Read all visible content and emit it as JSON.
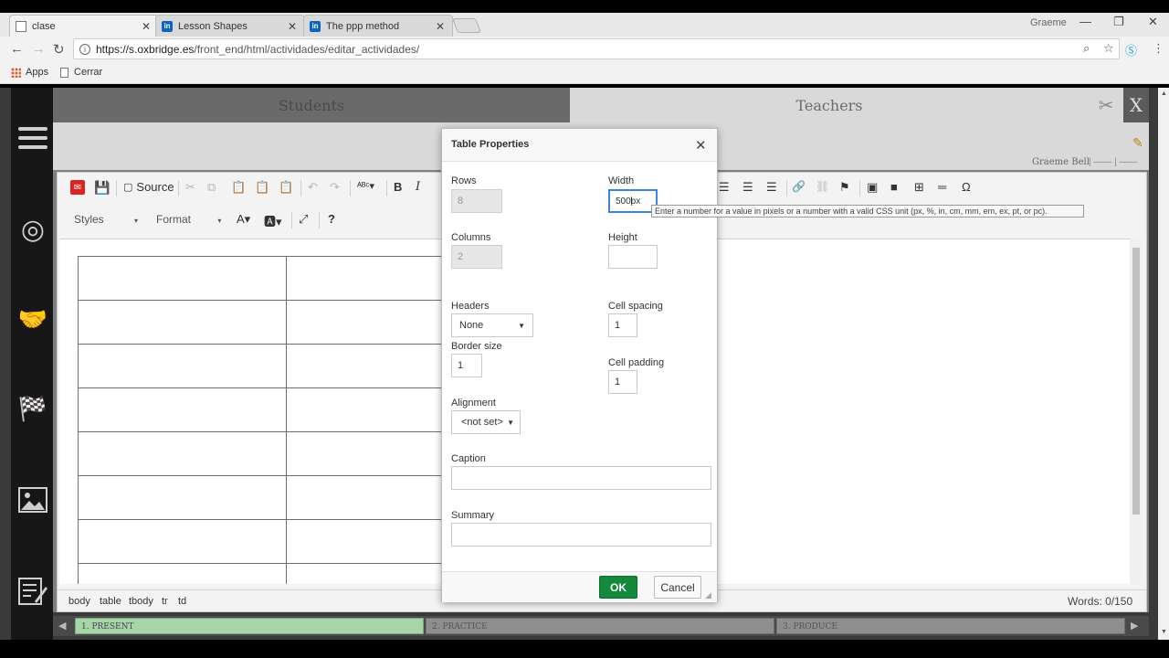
{
  "browser": {
    "tabs": [
      {
        "title": "clase",
        "icon": "document-icon"
      },
      {
        "title": "Lesson Shapes",
        "icon": "linkedin-icon"
      },
      {
        "title": "The ppp method",
        "icon": "linkedin-icon"
      }
    ],
    "window_user": "Graeme",
    "url_host": "https://s.oxbridge.es",
    "url_path": "/front_end/html/actividades/editar_actividades/",
    "bookmarks": [
      "Apps",
      "Cerrar"
    ]
  },
  "app": {
    "tabs": {
      "students": "Students",
      "teachers": "Teachers"
    },
    "close_label": "X",
    "author": "Graeme Bell"
  },
  "editor": {
    "source_label": "Source",
    "styles_label": "Styles",
    "format_label": "Format",
    "bold": "B",
    "italic": "I",
    "help": "?",
    "omega": "Ω",
    "path": [
      "body",
      "table",
      "tbody",
      "tr",
      "td"
    ],
    "words": "Words: 0/150"
  },
  "stages": [
    "1. PRESENT",
    "2. PRACTICE",
    "3. PRODUCE"
  ],
  "dialog": {
    "title": "Table Properties",
    "rows_label": "Rows",
    "rows_value": "8",
    "columns_label": "Columns",
    "columns_value": "2",
    "width_label": "Width",
    "width_value": "500px",
    "height_label": "Height",
    "height_value": "",
    "headers_label": "Headers",
    "headers_value": "None",
    "cell_spacing_label": "Cell spacing",
    "cell_spacing_value": "1",
    "border_label": "Border size",
    "border_value": "1",
    "cell_padding_label": "Cell padding",
    "cell_padding_value": "1",
    "alignment_label": "Alignment",
    "alignment_value": "<not set>",
    "caption_label": "Caption",
    "caption_value": "",
    "summary_label": "Summary",
    "summary_value": "",
    "ok_label": "OK",
    "cancel_label": "Cancel"
  },
  "tooltip": "Enter a number for a value in pixels or a number with a valid CSS unit (px, %, in, cm, mm, em, ex, pt, or pc)."
}
